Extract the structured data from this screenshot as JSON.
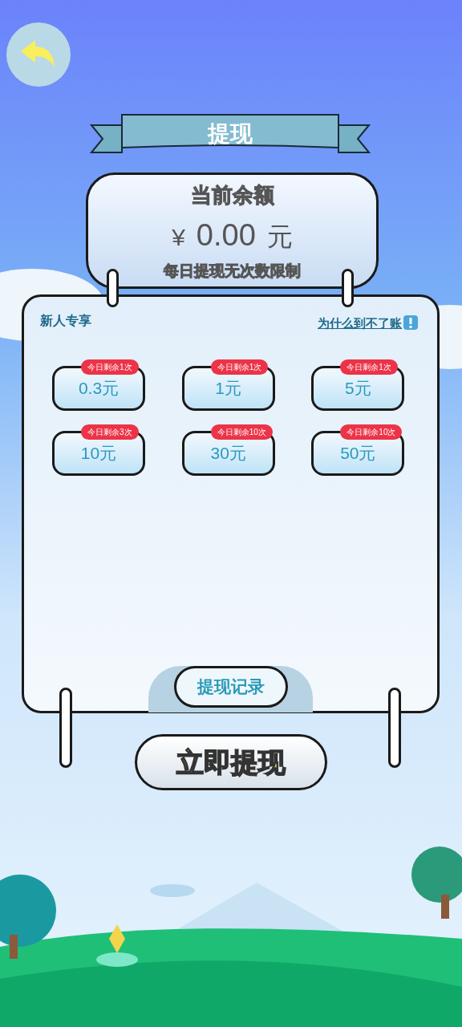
{
  "title": "提现",
  "balance": {
    "label": "当前余额",
    "currency": "¥",
    "amount": "0.00",
    "unit": "元",
    "note": "每日提现无次数限制"
  },
  "panel": {
    "section_label": "新人专享",
    "help_link": "为什么到不了账",
    "options": [
      {
        "amount": "0.3元",
        "remaining": "今日剩余1次"
      },
      {
        "amount": "1元",
        "remaining": "今日剩余1次"
      },
      {
        "amount": "5元",
        "remaining": "今日剩余1次"
      },
      {
        "amount": "10元",
        "remaining": "今日剩余3次"
      },
      {
        "amount": "30元",
        "remaining": "今日剩余10次"
      },
      {
        "amount": "50元",
        "remaining": "今日剩余10次"
      }
    ],
    "record_button": "提现记录"
  },
  "withdraw_button": "立即提现"
}
